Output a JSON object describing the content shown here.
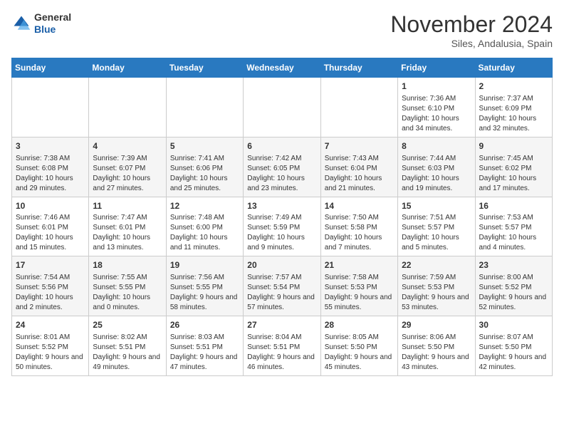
{
  "header": {
    "logo_line1": "General",
    "logo_line2": "Blue",
    "title": "November 2024",
    "subtitle": "Siles, Andalusia, Spain"
  },
  "weekdays": [
    "Sunday",
    "Monday",
    "Tuesday",
    "Wednesday",
    "Thursday",
    "Friday",
    "Saturday"
  ],
  "weeks": [
    [
      {
        "day": "",
        "info": ""
      },
      {
        "day": "",
        "info": ""
      },
      {
        "day": "",
        "info": ""
      },
      {
        "day": "",
        "info": ""
      },
      {
        "day": "",
        "info": ""
      },
      {
        "day": "1",
        "info": "Sunrise: 7:36 AM\nSunset: 6:10 PM\nDaylight: 10 hours and 34 minutes."
      },
      {
        "day": "2",
        "info": "Sunrise: 7:37 AM\nSunset: 6:09 PM\nDaylight: 10 hours and 32 minutes."
      }
    ],
    [
      {
        "day": "3",
        "info": "Sunrise: 7:38 AM\nSunset: 6:08 PM\nDaylight: 10 hours and 29 minutes."
      },
      {
        "day": "4",
        "info": "Sunrise: 7:39 AM\nSunset: 6:07 PM\nDaylight: 10 hours and 27 minutes."
      },
      {
        "day": "5",
        "info": "Sunrise: 7:41 AM\nSunset: 6:06 PM\nDaylight: 10 hours and 25 minutes."
      },
      {
        "day": "6",
        "info": "Sunrise: 7:42 AM\nSunset: 6:05 PM\nDaylight: 10 hours and 23 minutes."
      },
      {
        "day": "7",
        "info": "Sunrise: 7:43 AM\nSunset: 6:04 PM\nDaylight: 10 hours and 21 minutes."
      },
      {
        "day": "8",
        "info": "Sunrise: 7:44 AM\nSunset: 6:03 PM\nDaylight: 10 hours and 19 minutes."
      },
      {
        "day": "9",
        "info": "Sunrise: 7:45 AM\nSunset: 6:02 PM\nDaylight: 10 hours and 17 minutes."
      }
    ],
    [
      {
        "day": "10",
        "info": "Sunrise: 7:46 AM\nSunset: 6:01 PM\nDaylight: 10 hours and 15 minutes."
      },
      {
        "day": "11",
        "info": "Sunrise: 7:47 AM\nSunset: 6:01 PM\nDaylight: 10 hours and 13 minutes."
      },
      {
        "day": "12",
        "info": "Sunrise: 7:48 AM\nSunset: 6:00 PM\nDaylight: 10 hours and 11 minutes."
      },
      {
        "day": "13",
        "info": "Sunrise: 7:49 AM\nSunset: 5:59 PM\nDaylight: 10 hours and 9 minutes."
      },
      {
        "day": "14",
        "info": "Sunrise: 7:50 AM\nSunset: 5:58 PM\nDaylight: 10 hours and 7 minutes."
      },
      {
        "day": "15",
        "info": "Sunrise: 7:51 AM\nSunset: 5:57 PM\nDaylight: 10 hours and 5 minutes."
      },
      {
        "day": "16",
        "info": "Sunrise: 7:53 AM\nSunset: 5:57 PM\nDaylight: 10 hours and 4 minutes."
      }
    ],
    [
      {
        "day": "17",
        "info": "Sunrise: 7:54 AM\nSunset: 5:56 PM\nDaylight: 10 hours and 2 minutes."
      },
      {
        "day": "18",
        "info": "Sunrise: 7:55 AM\nSunset: 5:55 PM\nDaylight: 10 hours and 0 minutes."
      },
      {
        "day": "19",
        "info": "Sunrise: 7:56 AM\nSunset: 5:55 PM\nDaylight: 9 hours and 58 minutes."
      },
      {
        "day": "20",
        "info": "Sunrise: 7:57 AM\nSunset: 5:54 PM\nDaylight: 9 hours and 57 minutes."
      },
      {
        "day": "21",
        "info": "Sunrise: 7:58 AM\nSunset: 5:53 PM\nDaylight: 9 hours and 55 minutes."
      },
      {
        "day": "22",
        "info": "Sunrise: 7:59 AM\nSunset: 5:53 PM\nDaylight: 9 hours and 53 minutes."
      },
      {
        "day": "23",
        "info": "Sunrise: 8:00 AM\nSunset: 5:52 PM\nDaylight: 9 hours and 52 minutes."
      }
    ],
    [
      {
        "day": "24",
        "info": "Sunrise: 8:01 AM\nSunset: 5:52 PM\nDaylight: 9 hours and 50 minutes."
      },
      {
        "day": "25",
        "info": "Sunrise: 8:02 AM\nSunset: 5:51 PM\nDaylight: 9 hours and 49 minutes."
      },
      {
        "day": "26",
        "info": "Sunrise: 8:03 AM\nSunset: 5:51 PM\nDaylight: 9 hours and 47 minutes."
      },
      {
        "day": "27",
        "info": "Sunrise: 8:04 AM\nSunset: 5:51 PM\nDaylight: 9 hours and 46 minutes."
      },
      {
        "day": "28",
        "info": "Sunrise: 8:05 AM\nSunset: 5:50 PM\nDaylight: 9 hours and 45 minutes."
      },
      {
        "day": "29",
        "info": "Sunrise: 8:06 AM\nSunset: 5:50 PM\nDaylight: 9 hours and 43 minutes."
      },
      {
        "day": "30",
        "info": "Sunrise: 8:07 AM\nSunset: 5:50 PM\nDaylight: 9 hours and 42 minutes."
      }
    ]
  ]
}
